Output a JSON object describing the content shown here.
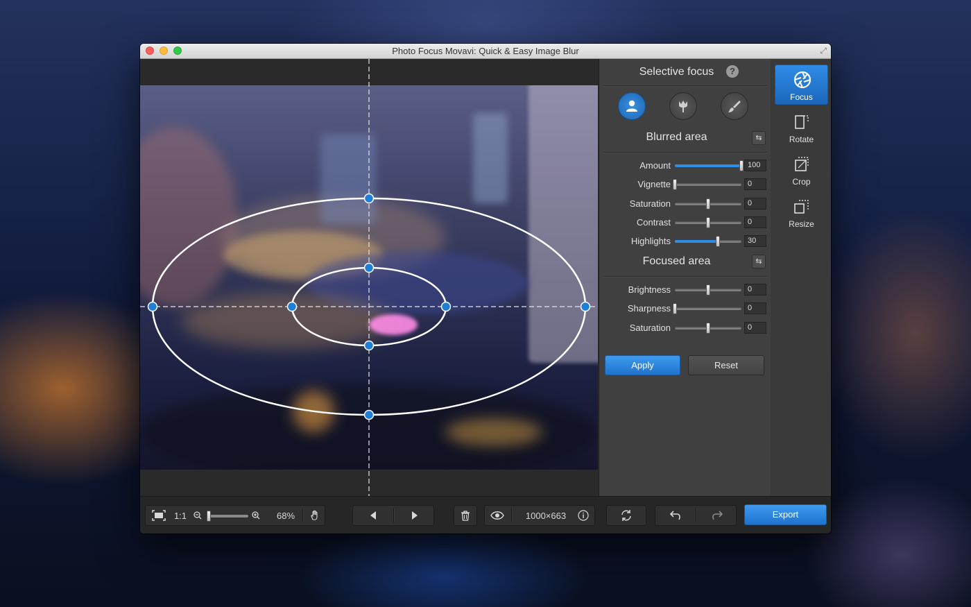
{
  "window": {
    "title": "Photo Focus Movavi: Quick & Easy Image Blur"
  },
  "panel": {
    "title": "Selective focus",
    "help_label": "?",
    "modes": [
      {
        "icon": "person-icon",
        "active": true
      },
      {
        "icon": "tulip-icon",
        "active": false
      },
      {
        "icon": "brush-icon",
        "active": false
      }
    ],
    "blurred": {
      "title": "Blurred area",
      "sliders": [
        {
          "label": "Amount",
          "value": "100",
          "position": 1.0,
          "filled": true
        },
        {
          "label": "Vignette",
          "value": "0",
          "position": 0.0,
          "filled": false
        },
        {
          "label": "Saturation",
          "value": "0",
          "position": 0.5,
          "filled": false
        },
        {
          "label": "Contrast",
          "value": "0",
          "position": 0.5,
          "filled": false
        },
        {
          "label": "Highlights",
          "value": "30",
          "position": 0.65,
          "filled": true
        }
      ]
    },
    "focused": {
      "title": "Focused area",
      "sliders": [
        {
          "label": "Brightness",
          "value": "0",
          "position": 0.5,
          "filled": false
        },
        {
          "label": "Sharpness",
          "value": "0",
          "position": 0.0,
          "filled": false
        },
        {
          "label": "Saturation",
          "value": "0",
          "position": 0.5,
          "filled": false
        }
      ]
    },
    "apply_label": "Apply",
    "reset_label": "Reset"
  },
  "tools": [
    {
      "label": "Focus",
      "icon": "aperture-icon",
      "active": true
    },
    {
      "label": "Rotate",
      "icon": "rotate-icon",
      "active": false
    },
    {
      "label": "Crop",
      "icon": "crop-icon",
      "active": false
    },
    {
      "label": "Resize",
      "icon": "resize-icon",
      "active": false
    }
  ],
  "bottombar": {
    "one_to_one": "1:1",
    "zoom_percent": "68%",
    "zoom_level": 0.05,
    "dimensions": "1000×663",
    "export_label": "Export"
  },
  "colors": {
    "accent": "#2a84dd",
    "handle": "#1f7fd6",
    "panel_bg": "#404040"
  }
}
